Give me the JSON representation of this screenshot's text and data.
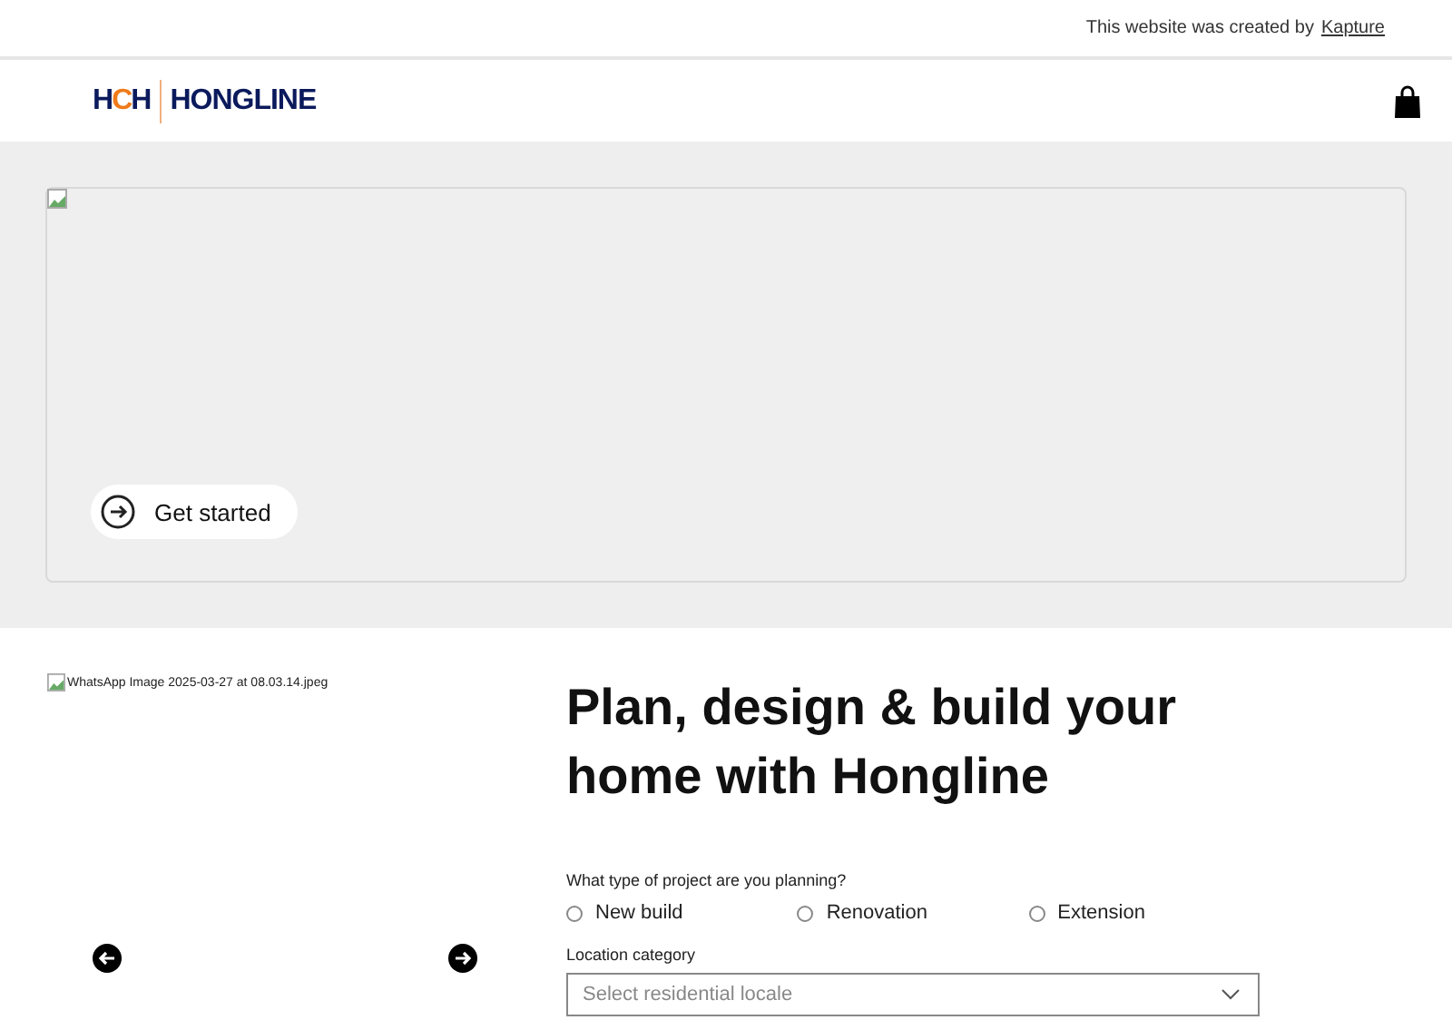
{
  "credit_bar": {
    "text": "This website was created by",
    "link": "Kapture"
  },
  "header": {
    "logo_mark": [
      "H",
      "C",
      "H"
    ],
    "brand": "HONGLINE"
  },
  "hero": {
    "button": "Get started"
  },
  "gallery": {
    "image_alt": "WhatsApp Image 2025-03-27 at 08.03.14.jpeg"
  },
  "form": {
    "title": "Plan, design & build your home with Hongline",
    "question": "What type of project are you planning?",
    "options": [
      {
        "label": "New build",
        "selected": false
      },
      {
        "label": "Renovation",
        "selected": false
      },
      {
        "label": "Extension",
        "selected": false
      }
    ],
    "location_label": "Location category",
    "location_placeholder": "Select residential locale"
  }
}
